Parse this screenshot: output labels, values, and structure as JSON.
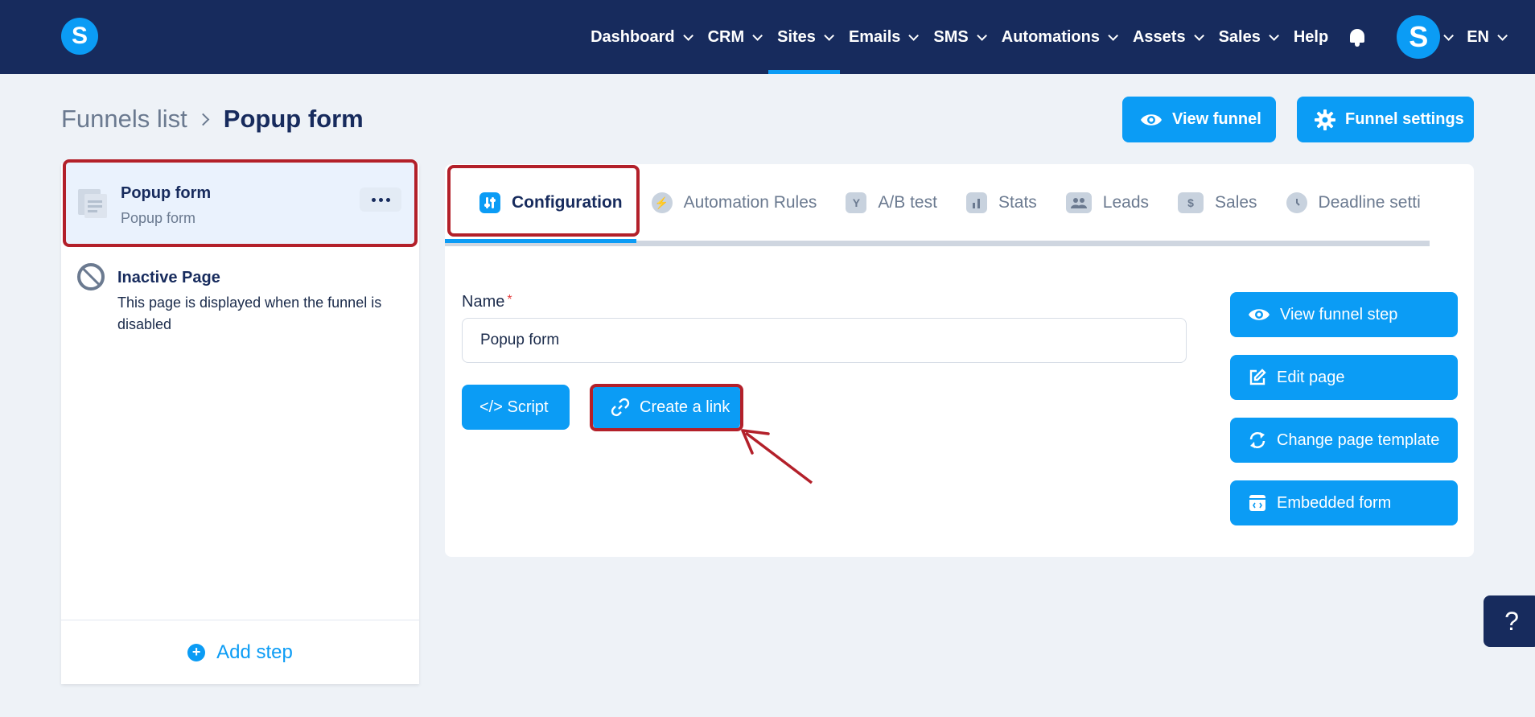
{
  "nav": {
    "items": [
      "Dashboard",
      "CRM",
      "Sites",
      "Emails",
      "SMS",
      "Automations",
      "Assets",
      "Sales"
    ],
    "help": "Help",
    "avatar_letter": "S",
    "logo_letter": "S",
    "language": "EN",
    "active": "Sites"
  },
  "breadcrumb": {
    "parent": "Funnels list",
    "current": "Popup form"
  },
  "header_buttons": {
    "view_funnel": "View funnel",
    "funnel_settings": "Funnel settings"
  },
  "steps": [
    {
      "title": "Popup form",
      "subtitle": "Popup form"
    },
    {
      "title": "Inactive Page",
      "description": "This page is displayed when the funnel is disabled"
    }
  ],
  "add_step": "Add step",
  "tabs": [
    "Configuration",
    "Automation Rules",
    "A/B test",
    "Stats",
    "Leads",
    "Sales",
    "Deadline setti"
  ],
  "form": {
    "name_label": "Name",
    "required_mark": "*",
    "name_value": "Popup form",
    "script_button": "</> Script",
    "create_link_button": "Create a link"
  },
  "side_buttons": [
    "View funnel step",
    "Edit page",
    "Change page template",
    "Embedded form"
  ],
  "help_fab": "?",
  "colors": {
    "nav_bg": "#172b5d",
    "accent": "#0b9cf5",
    "highlight": "#b3202a",
    "page_bg": "#eef2f7"
  }
}
